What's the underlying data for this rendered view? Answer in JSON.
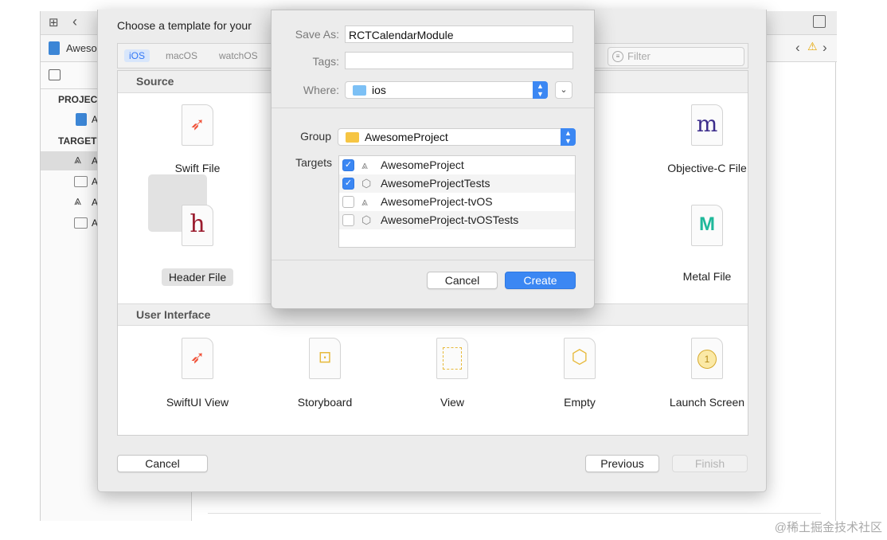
{
  "sidebar": {
    "file_tab_label": "Aweso",
    "sections": {
      "project": "PROJEC",
      "targets": "TARGET"
    },
    "items": [
      {
        "label": "A"
      },
      {
        "label": "A"
      },
      {
        "label": "A"
      },
      {
        "label": "A"
      },
      {
        "label": "A"
      }
    ]
  },
  "template_sheet": {
    "title": "Choose a template for your",
    "platforms": [
      "iOS",
      "macOS",
      "watchOS"
    ],
    "active_platform": "iOS",
    "filter_placeholder": "Filter",
    "sections": [
      {
        "title": "Source",
        "templates": [
          {
            "label": "Swift File",
            "icon": "swift-icon"
          },
          {
            "label": "Objective-C File",
            "icon": "m-icon"
          },
          {
            "label": "Header File",
            "icon": "h-icon",
            "selected": true
          },
          {
            "label": "Metal File",
            "icon": "metal-icon"
          }
        ]
      },
      {
        "title": "User Interface",
        "templates": [
          {
            "label": "SwiftUI View",
            "icon": "swift-icon"
          },
          {
            "label": "Storyboard",
            "icon": "storyboard-icon"
          },
          {
            "label": "View",
            "icon": "view-icon"
          },
          {
            "label": "Empty",
            "icon": "empty-icon"
          },
          {
            "label": "Launch Screen",
            "icon": "launch-screen-icon"
          }
        ]
      }
    ],
    "buttons": {
      "cancel": "Cancel",
      "previous": "Previous",
      "finish": "Finish"
    }
  },
  "save_dialog": {
    "save_as_label": "Save As:",
    "save_as_value": "RCTCalendarModule",
    "tags_label": "Tags:",
    "tags_value": "",
    "where_label": "Where:",
    "where_value": "ios",
    "group_label": "Group",
    "group_value": "AwesomeProject",
    "targets_label": "Targets",
    "targets": [
      {
        "name": "AwesomeProject",
        "checked": true
      },
      {
        "name": "AwesomeProjectTests",
        "checked": true
      },
      {
        "name": "AwesomeProject-tvOS",
        "checked": false
      },
      {
        "name": "AwesomeProject-tvOSTests",
        "checked": false
      }
    ],
    "cancel_label": "Cancel",
    "create_label": "Create"
  },
  "watermark": "@稀土掘金技术社区",
  "colors": {
    "accent": "#3b87f3",
    "folder": "#7cc0f5",
    "group_folder": "#f6c543",
    "swift": "#f05138",
    "objc_m": "#3d2e8c",
    "header_h": "#9b1c2e",
    "metal": "#1fb89a",
    "ui_yellow": "#e7b93b"
  }
}
